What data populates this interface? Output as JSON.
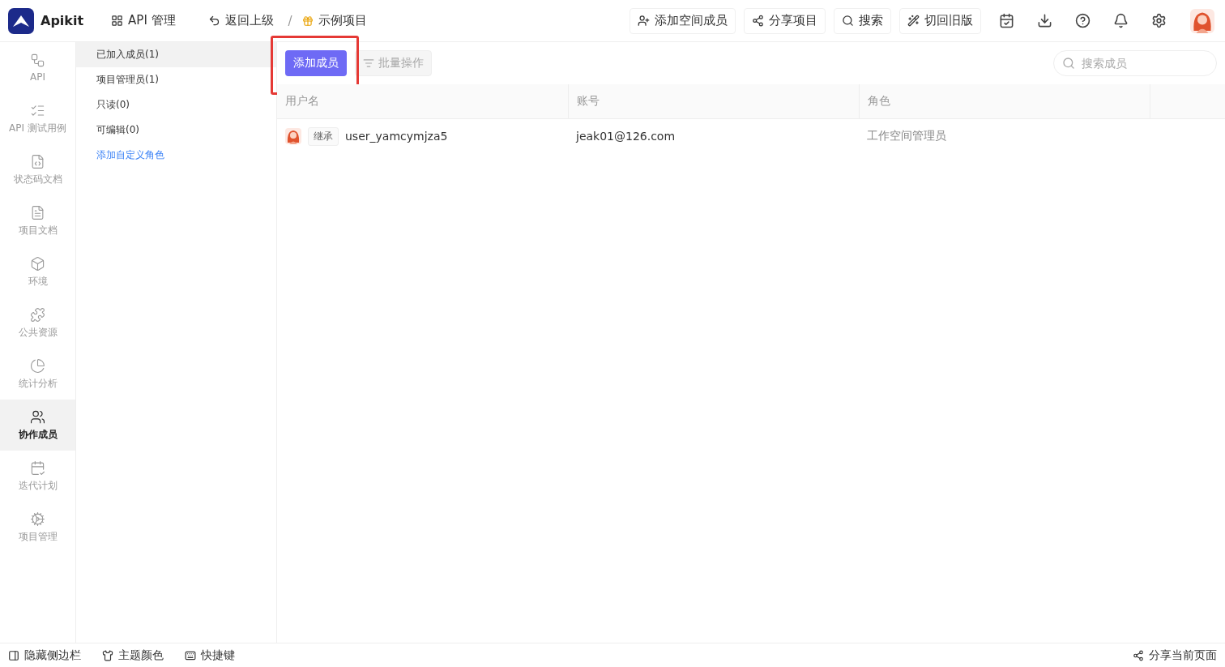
{
  "app": {
    "name": "Apikit"
  },
  "topbar": {
    "menu": "API 管理",
    "back": "返回上级",
    "separator": "/",
    "project": "示例项目",
    "actions": [
      "添加空间成员",
      "分享项目",
      "搜索",
      "切回旧版"
    ]
  },
  "nav": [
    {
      "label": "API",
      "selected": false
    },
    {
      "label": "API 测试用例",
      "selected": false
    },
    {
      "label": "状态码文档",
      "selected": false
    },
    {
      "label": "项目文档",
      "selected": false
    },
    {
      "label": "环境",
      "selected": false
    },
    {
      "label": "公共资源",
      "selected": false
    },
    {
      "label": "统计分析",
      "selected": false
    },
    {
      "label": "协作成员",
      "selected": true
    },
    {
      "label": "迭代计划",
      "selected": false
    },
    {
      "label": "项目管理",
      "selected": false
    }
  ],
  "roles": {
    "items": [
      {
        "label": "已加入成员(1)",
        "selected": true
      },
      {
        "label": "项目管理员(1)",
        "selected": false
      },
      {
        "label": "只读(0)",
        "selected": false
      },
      {
        "label": "可编辑(0)",
        "selected": false
      }
    ],
    "add_link": "添加自定义角色"
  },
  "toolbar": {
    "add_button": "添加成员",
    "batch_button": {
      "label": "批量操作",
      "disabled": true
    },
    "search": {
      "placeholder": "搜索成员"
    },
    "highlighted": true
  },
  "table": {
    "columns": [
      "用户名",
      "账号",
      "角色"
    ],
    "rows": [
      {
        "tag": "继承",
        "username": "user_yamcymjza5",
        "account": "jeak01@126.com",
        "role": "工作空间管理员"
      }
    ]
  },
  "footer": {
    "left": [
      "隐藏侧边栏",
      "主题颜色",
      "快捷键"
    ],
    "right": "分享当前页面"
  }
}
